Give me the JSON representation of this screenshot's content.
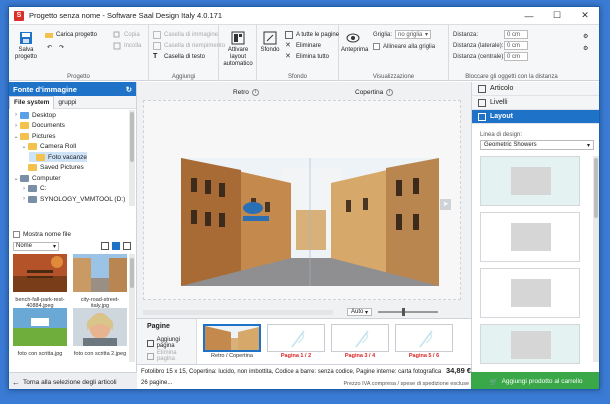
{
  "window": {
    "title": "Progetto senza nome - Software Saal Design Italy 4.0.171",
    "app_icon": "S"
  },
  "ribbon": {
    "progetto": {
      "label": "Progetto",
      "save": "Salva progetto",
      "load": "Carica progetto",
      "copy": "Copia",
      "paste": "Incolla"
    },
    "aggiungi": {
      "label": "Aggiungi",
      "image_box": "Casella di immagine",
      "background_box": "Casella di riempimento",
      "text_box": "Casella di testo"
    },
    "layout_btn": "Attivare layout automatico",
    "sfondo": {
      "label": "Sfondo",
      "btn": "Sfondo",
      "all_pages": "A tutte le pagine",
      "remove": "Eliminare",
      "remove_all": "Elimina tutto"
    },
    "visualizzazione": {
      "label": "Visualizzazione",
      "preview": "Anteprima",
      "grid_label": "Griglia:",
      "grid_value": "no griglia",
      "align_grid": "Allineare alla griglia"
    },
    "bloccare": {
      "label": "Bloccare gli oggetti con la distanza",
      "dist": "Distanza:",
      "dist_side": "Distanza (laterale):",
      "dist_center": "Distanza (centrale):",
      "value1": "0 cm",
      "value2": "0 cm",
      "value3": "0 cm"
    }
  },
  "left_panel": {
    "header": "Fonte d'immagine",
    "tabs": [
      "File system",
      "gruppi"
    ],
    "tree": [
      {
        "label": "Desktop",
        "indent": 0,
        "arrow": "›",
        "icon": "folder-blue"
      },
      {
        "label": "Documents",
        "indent": 0,
        "arrow": "›",
        "icon": "folder"
      },
      {
        "label": "Pictures",
        "indent": 0,
        "arrow": "⌄",
        "icon": "folder"
      },
      {
        "label": "Camera Roll",
        "indent": 1,
        "arrow": "⌄",
        "icon": "folder"
      },
      {
        "label": "Foto vacanze",
        "indent": 2,
        "arrow": "",
        "icon": "folder",
        "selected": true
      },
      {
        "label": "Saved Pictures",
        "indent": 1,
        "arrow": "",
        "icon": "folder"
      },
      {
        "label": "Computer",
        "indent": 0,
        "arrow": "⌄",
        "icon": "pc"
      },
      {
        "label": "C:",
        "indent": 1,
        "arrow": "›",
        "icon": "pc"
      },
      {
        "label": "SYNOLOGY_VMMTOOL (D:)",
        "indent": 1,
        "arrow": "›",
        "icon": "pc"
      }
    ],
    "show_names": "Mostra nome file",
    "sort_value": "Nome",
    "thumbnails": [
      {
        "caption": "bench-fall-park-rest-40884.jpeg"
      },
      {
        "caption": "city-road-street-italy.jpg"
      },
      {
        "caption": "foto con scritta.jpg"
      },
      {
        "caption": "foto con scritta 2.jpeg"
      }
    ],
    "footer": "Torna alla selezione degli articoli"
  },
  "canvas": {
    "label_left": "Retro",
    "label_right": "Copertina",
    "zoom_value": "Auto"
  },
  "pages_panel": {
    "title": "Pagine",
    "add": "Aggiungi pagina",
    "remove": "Elimina pagina",
    "pages": [
      {
        "label": "Retro / Copertina",
        "selected": true
      },
      {
        "label": "Pagina 1 / 2"
      },
      {
        "label": "Pagina 3 / 4"
      },
      {
        "label": "Pagina 5 / 6"
      }
    ]
  },
  "status": {
    "line1": "Fotolibro 15 x 15, Copertina: lucido, non imbottita, Codice a barre: senza codice, Pagine interne: carta fotografica",
    "line2": "26 pagine...",
    "price": "34,89 €",
    "vat": "Prezzo IVA compresa / spese di spedizione escluse"
  },
  "right_panel": {
    "tabs": [
      "Articolo",
      "Livelli",
      "Layout"
    ],
    "design_label": "Linea di design:",
    "design_value": "Geometric Showers",
    "footer": "Aggiungi prodotto al carrello"
  },
  "colors": {
    "accent": "#1e73c8",
    "cart_green": "#3aa748",
    "price_red": "#d22222"
  }
}
